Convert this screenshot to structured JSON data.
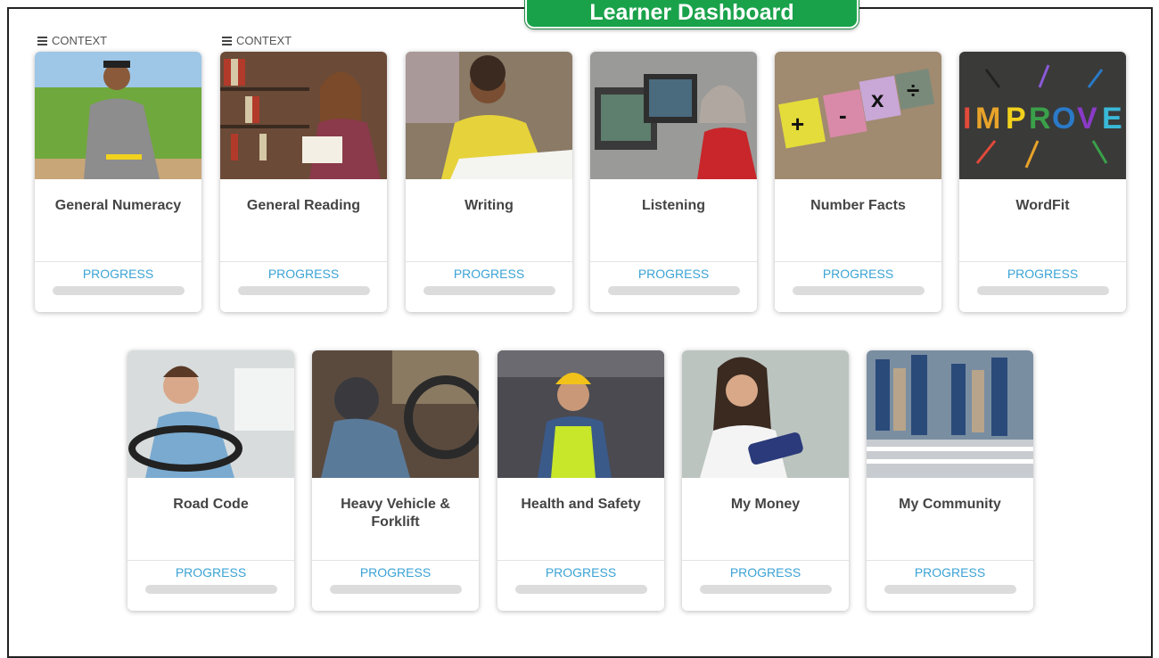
{
  "header": {
    "title": "Learner Dashboard"
  },
  "context_label": "CONTEXT",
  "progress_label": "PROGRESS",
  "cards": [
    {
      "title": "General Numeracy",
      "image": "man-in-field-holding-pencil",
      "progress": 0
    },
    {
      "title": "General Reading",
      "image": "woman-reading-in-library",
      "progress": 0
    },
    {
      "title": "Writing",
      "image": "man-writing-at-desk",
      "progress": 0
    },
    {
      "title": "Listening",
      "image": "woman-on-phone-at-computer",
      "progress": 0
    },
    {
      "title": "Number Facts",
      "image": "math-operator-blocks",
      "progress": 0
    },
    {
      "title": "WordFit",
      "image": "improve-letters-chalkboard",
      "progress": 0
    },
    {
      "title": "Road Code",
      "image": "man-driving-car",
      "progress": 0
    },
    {
      "title": "Heavy Vehicle & Forklift",
      "image": "truck-driver-cab",
      "progress": 0
    },
    {
      "title": "Health and Safety",
      "image": "worker-hardhat-hivis",
      "progress": 0
    },
    {
      "title": "My Money",
      "image": "woman-with-purse",
      "progress": 0
    },
    {
      "title": "My Community",
      "image": "people-crossing-street",
      "progress": 0
    }
  ],
  "colors": {
    "banner": "#1aa24b",
    "progress_text": "#3ba3d5",
    "track": "#dcdcdc"
  }
}
